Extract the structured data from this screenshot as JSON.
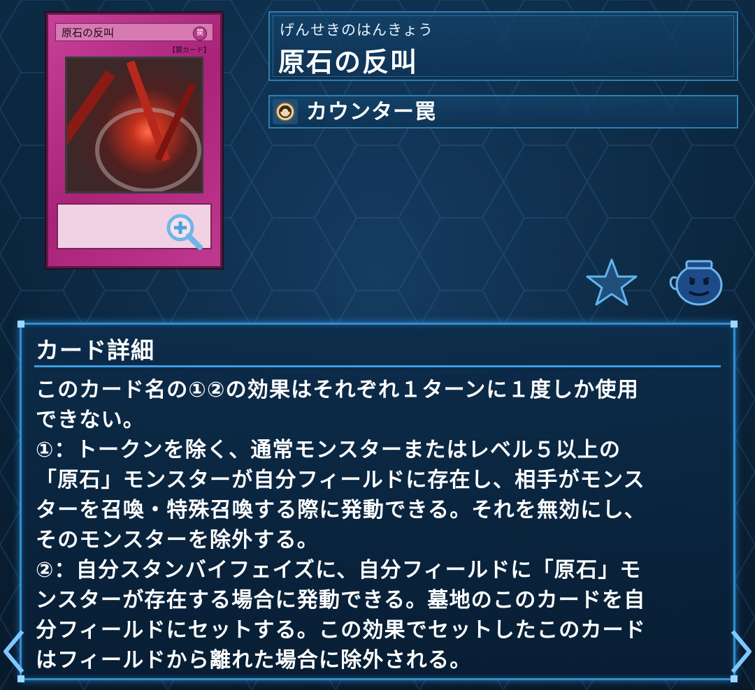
{
  "card": {
    "name_reading": "げんせきのはんきょう",
    "name": "原石の反叫",
    "card_face_name": "原石の反叫",
    "card_face_type": "【罠カード】",
    "card_face_attribute": "罠",
    "type_label": "カウンター罠"
  },
  "icons": {
    "zoom": "magnifier-plus-icon",
    "type": "counter-trap-icon",
    "favorite": "star-icon",
    "pot": "pot-of-greed-icon",
    "nav_left": "chevron-left-icon",
    "nav_right": "chevron-right-icon"
  },
  "detail": {
    "title": "カード詳細",
    "text": "このカード名の①②の効果はそれぞれ１ターンに１度しか使用\nできない。\n①：トークンを除く、通常モンスターまたはレベル５以上の\n「原石」モンスターが自分フィールドに存在し、相手がモンス\nターを召喚・特殊召喚する際に発動できる。それを無効にし、\nそのモンスターを除外する。\n②：自分スタンバイフェイズに、自分フィールドに「原石」モ\nンスターが存在する場合に発動できる。墓地のこのカードを自\n分フィールドにセットする。この効果でセットしたこのカード\nはフィールドから離れた場合に除外される。"
  },
  "colors": {
    "accent": "#2f8fd0",
    "trap_card": "#b52c86",
    "background": "#0a2238"
  }
}
